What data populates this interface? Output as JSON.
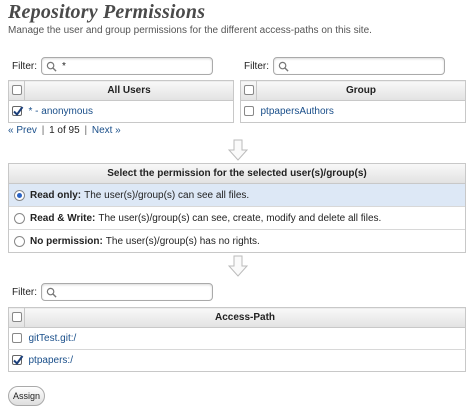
{
  "page": {
    "title": "Repository Permissions",
    "subtitle": "Manage the user and group permissions for the different access-paths on this site."
  },
  "users_panel": {
    "filter_label": "Filter:",
    "filter_value": "*",
    "column_header": "All Users",
    "rows": [
      {
        "label": "* - anonymous",
        "checked": true
      }
    ],
    "pager": {
      "prev": "« Prev",
      "info": "1 of 95",
      "next": "Next »"
    }
  },
  "groups_panel": {
    "filter_label": "Filter:",
    "filter_value": "",
    "column_header": "Group",
    "rows": [
      {
        "label": "ptpapersAuthors",
        "checked": false
      }
    ]
  },
  "permission_panel": {
    "header": "Select the permission for the selected user(s)/group(s)",
    "options": [
      {
        "name": "Read only:",
        "description": "The user(s)/group(s) can see all files.",
        "selected": true
      },
      {
        "name": "Read & Write:",
        "description": "The user(s)/group(s) can see, create, modify and delete all files.",
        "selected": false
      },
      {
        "name": "No permission:",
        "description": "The user(s)/group(s) has no rights.",
        "selected": false
      }
    ]
  },
  "access_panel": {
    "filter_label": "Filter:",
    "filter_value": "",
    "column_header": "Access-Path",
    "rows": [
      {
        "label": "gitTest.git:/",
        "checked": false
      },
      {
        "label": "ptpapers:/",
        "checked": true
      }
    ]
  },
  "assign_button": "Assign",
  "colors": {
    "link": "#1a4f8a",
    "selected_row": "#dde8f6",
    "radio_dot": "#2a63c4"
  }
}
